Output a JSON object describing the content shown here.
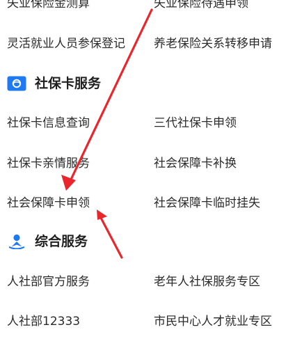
{
  "top_section": {
    "items": [
      {
        "label": "失业保险金测算"
      },
      {
        "label": "失业保险待遇申领"
      },
      {
        "label": "灵活就业人员参保登记"
      },
      {
        "label": "养老保险关系转移申请"
      }
    ]
  },
  "social_card_section": {
    "title": "社保卡服务",
    "icon": "social-security-card-icon",
    "items": [
      {
        "label": "社保卡信息查询"
      },
      {
        "label": "三代社保卡申领"
      },
      {
        "label": "社保卡亲情服务"
      },
      {
        "label": "社会保障卡补换"
      },
      {
        "label": "社会保障卡申领"
      },
      {
        "label": "社会保障卡临时挂失"
      }
    ]
  },
  "general_section": {
    "title": "综合服务",
    "icon": "person-location-icon",
    "items": [
      {
        "label": "人社部官方服务"
      },
      {
        "label": "老年人社保服务专区"
      },
      {
        "label": "人社部12333"
      },
      {
        "label": "市民中心人才就业专区"
      }
    ]
  },
  "colors": {
    "annotation_arrow": "#e8262b",
    "icon_blue": "#1e7af0"
  }
}
